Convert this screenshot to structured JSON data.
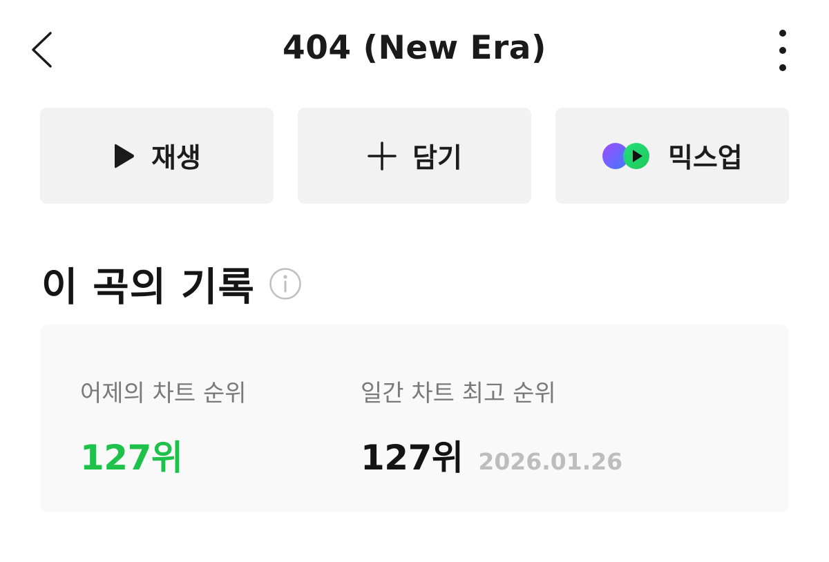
{
  "header": {
    "title": "404 (New Era)",
    "back_icon": "chevron-left-icon",
    "more_icon": "vertical-dots-icon"
  },
  "actions": [
    {
      "label": "재생",
      "icon": "play-icon"
    },
    {
      "label": "담기",
      "icon": "plus-icon"
    },
    {
      "label": "믹스업",
      "icon": "mixup-icon"
    }
  ],
  "records": {
    "title": "이 곡의 기록",
    "info_icon": "info-icon",
    "yesterday": {
      "label": "어제의 차트 순위",
      "value": "127위"
    },
    "peak": {
      "label": "일간 차트 최고 순위",
      "value": "127위",
      "date": "2026.01.26"
    }
  },
  "colors": {
    "accent_green": "#1ec24a",
    "button_bg": "#f2f2f2",
    "card_bg": "#f9f9f9",
    "mixup_gradient_start": "#7a5cff",
    "mixup_gradient_end": "#22e07a"
  }
}
